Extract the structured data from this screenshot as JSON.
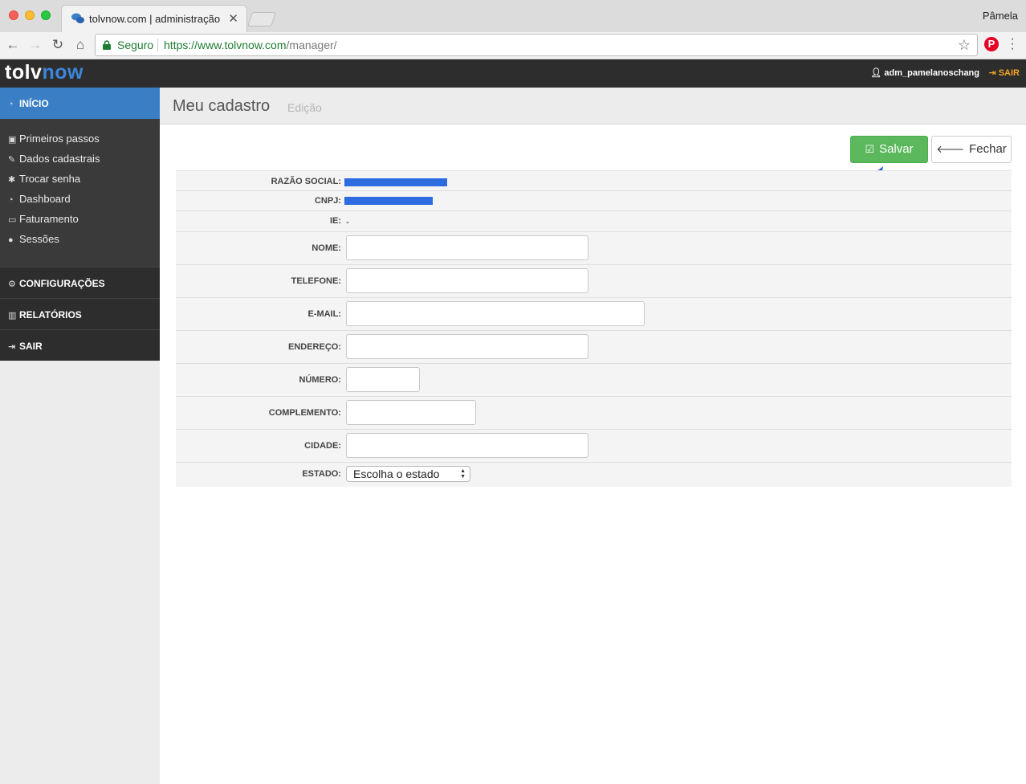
{
  "browser": {
    "tab_title": "tolvnow.com | administração",
    "tab_close": "✕",
    "profile": "Pâmela",
    "secure_label": "Seguro",
    "url_host": "https://www.tolvnow.com",
    "url_path": "/manager/",
    "icons": [
      "back-arrow-icon",
      "forward-arrow-icon",
      "reload-icon",
      "home-icon",
      "lock-icon",
      "star-icon",
      "pinterest-icon",
      "menu-kebab-icon"
    ]
  },
  "header": {
    "logo_a": "tolv",
    "logo_b": "now",
    "user": "adm_pamelanoschang",
    "logout": "SAIR",
    "accent": "#f5a623"
  },
  "sidebar": {
    "home": "INÍCIO",
    "sub_items": [
      {
        "label": "Primeiros passos",
        "icon": "briefcase-icon"
      },
      {
        "label": "Dados cadastrais",
        "icon": "edit-icon"
      },
      {
        "label": "Trocar senha",
        "icon": "asterisk-icon"
      },
      {
        "label": "Dashboard",
        "icon": "dashboard-icon"
      },
      {
        "label": "Faturamento",
        "icon": "money-icon"
      },
      {
        "label": "Sessões",
        "icon": "user-icon"
      }
    ],
    "main_items": [
      {
        "label": "CONFIGURAÇÕES",
        "icon": "cogs-icon"
      },
      {
        "label": "RELATÓRIOS",
        "icon": "bar-chart-icon"
      },
      {
        "label": "SAIR",
        "icon": "sign-out-icon"
      }
    ],
    "active_color": "#3a7fc6"
  },
  "page": {
    "title": "Meu cadastro",
    "subtitle": "Edição",
    "save": "Salvar",
    "close": "Fechar",
    "save_color": "#5cb85c"
  },
  "form": {
    "razao_label": "RAZÃO SOCIAL:",
    "cnpj_label": "CNPJ:",
    "ie_label": "IE:",
    "ie_value": "-",
    "nome_label": "NOME:",
    "telefone_label": "TELEFONE:",
    "email_label": "E-MAIL:",
    "endereco_label": "ENDEREÇO:",
    "numero_label": "NÚMERO:",
    "complemento_label": "COMPLEMENTO:",
    "cidade_label": "CIDADE:",
    "estado_label": "ESTADO:",
    "estado_value": "Escolha o estado"
  }
}
